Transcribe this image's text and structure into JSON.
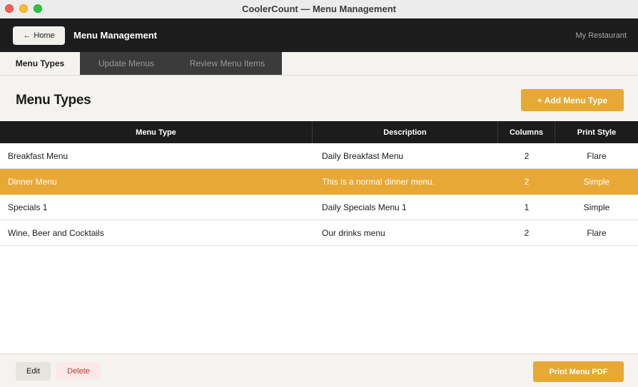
{
  "window": {
    "title": "CoolerCount — Menu Management"
  },
  "appbar": {
    "home_label": "Home",
    "home_icon": "arrow-left-icon",
    "title": "Menu Management",
    "restaurant": "My Restaurant"
  },
  "tabs": [
    {
      "label": "Menu Types",
      "active": true
    },
    {
      "label": "Update Menus",
      "active": false
    },
    {
      "label": "Review Menu Items",
      "active": false
    }
  ],
  "main": {
    "title": "Menu Types",
    "add_label": "+ Add Menu Type"
  },
  "table": {
    "columns": [
      "Menu Type",
      "Description",
      "Columns",
      "Print Style"
    ],
    "rows": [
      {
        "name": "Breakfast Menu",
        "description": "Daily Breakfast Menu",
        "columns": "2",
        "print_style": "Flare",
        "selected": false
      },
      {
        "name": "Dinner Menu",
        "description": "This is a normal dinner menu.",
        "columns": "2",
        "print_style": "Simple",
        "selected": true
      },
      {
        "name": "Specials 1",
        "description": "Daily Specials Menu 1",
        "columns": "1",
        "print_style": "Simple",
        "selected": false
      },
      {
        "name": "Wine, Beer and Cocktails",
        "description": "Our drinks menu",
        "columns": "2",
        "print_style": "Flare",
        "selected": false
      }
    ]
  },
  "footer": {
    "edit_label": "Edit",
    "delete_label": "Delete",
    "print_label": "Print Menu PDF"
  },
  "colors": {
    "accent": "#e8a835",
    "dark": "#1c1c1c",
    "danger": "#c0392b",
    "background": "#f4f3ef"
  }
}
